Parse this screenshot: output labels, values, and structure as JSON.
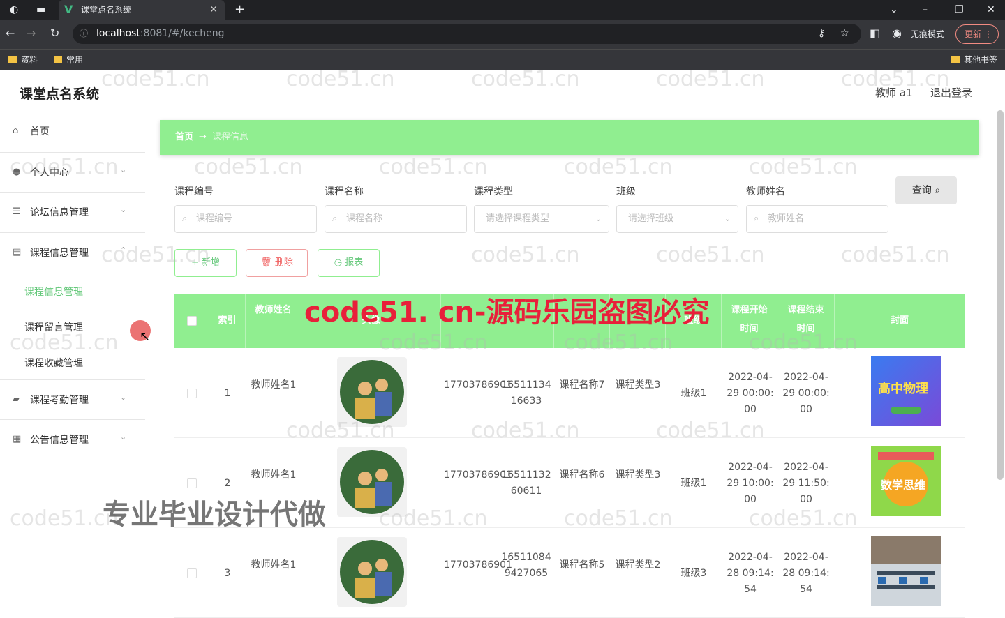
{
  "browser": {
    "tab_title": "课堂点名系统",
    "url_host": "localhost",
    "url_path": ":8081/#/kecheng",
    "incognito_label": "无痕模式",
    "update_label": "更新",
    "bookmarks": [
      "资料",
      "常用"
    ],
    "other_bookmarks": "其他书签"
  },
  "app": {
    "title": "课堂点名系统",
    "user_label": "教师 a1",
    "logout_label": "退出登录"
  },
  "sidebar": {
    "items": [
      {
        "label": "首页",
        "icon": "home-icon"
      },
      {
        "label": "个人中心",
        "icon": "user-icon"
      },
      {
        "label": "论坛信息管理",
        "icon": "menu-icon"
      },
      {
        "label": "课程信息管理",
        "icon": "book-icon"
      },
      {
        "label": "课程考勤管理",
        "icon": "briefcase-icon"
      },
      {
        "label": "公告信息管理",
        "icon": "grid-icon"
      }
    ],
    "subitems": [
      "课程信息管理",
      "课程留言管理",
      "课程收藏管理"
    ]
  },
  "breadcrumb": {
    "home": "首页",
    "arrow": "→",
    "current": "课程信息"
  },
  "filters": {
    "labels": [
      "课程编号",
      "课程名称",
      "课程类型",
      "班级",
      "教师姓名"
    ],
    "placeholders": [
      "课程编号",
      "课程名称",
      "请选择课程类型",
      "请选择班级",
      "教师姓名"
    ],
    "query_label": "查询"
  },
  "actions": {
    "add": "新增",
    "delete": "删除",
    "report": "报表"
  },
  "table": {
    "headers": [
      "索引",
      "教师姓名",
      "头像",
      "",
      "",
      "",
      "",
      "班级",
      "课程开始时间",
      "课程结束时间",
      "封面"
    ],
    "rows": [
      {
        "index": "1",
        "teacher": "教师姓名1",
        "c1": "17703786901",
        "c2": "1651113416633",
        "name": "课程名称7",
        "type": "课程类型3",
        "class": "班级1",
        "start": "2022-04-29 00:00:00",
        "end": "2022-04-29 00:00:00"
      },
      {
        "index": "2",
        "teacher": "教师姓名1",
        "c1": "17703786901",
        "c2": "1651113260611",
        "name": "课程名称6",
        "type": "课程类型3",
        "class": "班级1",
        "start": "2022-04-29 10:00:00",
        "end": "2022-04-29 11:50:00"
      },
      {
        "index": "3",
        "teacher": "教师姓名1",
        "c1": "17703786901",
        "c2": "165110849427065",
        "name": "课程名称5",
        "type": "课程类型2",
        "class": "班级3",
        "start": "2022-04-28 09:14:54",
        "end": "2022-04-28 09:14:54"
      }
    ],
    "covers": [
      "高中物理",
      "数学思维",
      ""
    ]
  },
  "watermarks": {
    "site": "code51.cn",
    "red": "code51. cn-源码乐园盗图必究",
    "gray": "专业毕业设计代做"
  }
}
